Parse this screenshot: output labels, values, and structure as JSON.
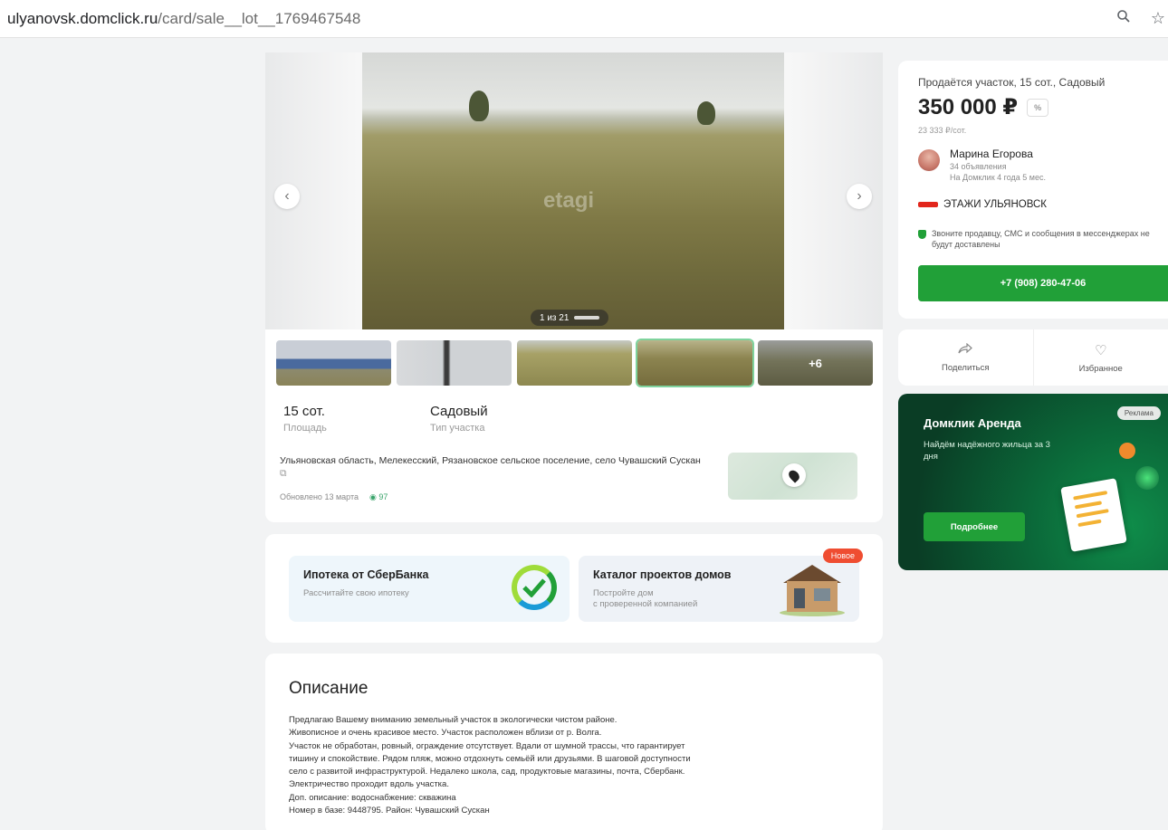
{
  "browser": {
    "url_host": "ulyanovsk.domclick.ru",
    "url_path": "/card/sale__lot__1769467548",
    "icons": [
      "zoom-icon",
      "star-icon"
    ]
  },
  "gallery": {
    "watermark": "etagi",
    "counter": "1 из 21",
    "prev_icon": "‹",
    "next_icon": "›"
  },
  "params": [
    {
      "value": "15 сот.",
      "label": "Площадь"
    },
    {
      "value": "Садовый",
      "label": "Тип участка"
    }
  ],
  "location": {
    "address": "Ульяновская область, Мелекесский, Рязановское сельское поселение, село Чувашский Сускан",
    "updated": "Обновлено 13 марта",
    "views": "97"
  },
  "promos": [
    {
      "title": "Ипотека от СберБанка",
      "subtitle": "Рассчитайте свою ипотеку"
    },
    {
      "title": "Каталог проектов домов",
      "subtitle": "Постройте дом\nс проверенной компанией",
      "badge": "Новое"
    }
  ],
  "description": {
    "heading": "Описание",
    "lines": [
      "Предлагаю Вашему вниманию земельный участок в экологически чистом районе.",
      "Живописное и очень красивое место. Участок расположен вблизи от р. Волга.",
      "Участок не обработан, ровный, ограждение отсутствует. Вдали от шумной трассы, что гарантирует",
      "тишину и спокойствие. Рядом пляж, можно отдохнуть семьёй или друзьями. В шаговой доступности",
      "село с развитой инфраструктурой. Недалеко школа, сад, продуктовые магазины, почта, Сбербанк.",
      "Электричество проходит вдоль участка.",
      "Доп. описание: водоснабжение: скважина",
      "Номер в базе: 9448795. Район: Чувашский Сускан"
    ]
  },
  "listing": {
    "title": "Продаётся участок, 15 сот., Садовый",
    "price": "350 000 ₽",
    "price_tag": "%",
    "price_per": "23 333 ₽/сот.",
    "seller_name": "Марина Егорова",
    "seller_ads": "34 объявления",
    "seller_since": "На Домклик 4 года 5 мес.",
    "agency": "ЭТАЖИ УЛЬЯНОВСК",
    "notice": "Звоните продавцу, СМС и сообщения в мессенджерах не будут доставлены",
    "phone": "+7 (908) 280-47-06"
  },
  "actions": {
    "share": "Поделиться",
    "favorite": "Избранное"
  },
  "ad": {
    "title": "Домклик Аренда",
    "subtitle": "Найдём надёжного жильца за 3 дня",
    "badge": "Реклама",
    "button": "Подробнее"
  },
  "colors": {
    "accent": "#21a038",
    "badge_new": "#ef4d31",
    "agency_red": "#e2261c"
  }
}
